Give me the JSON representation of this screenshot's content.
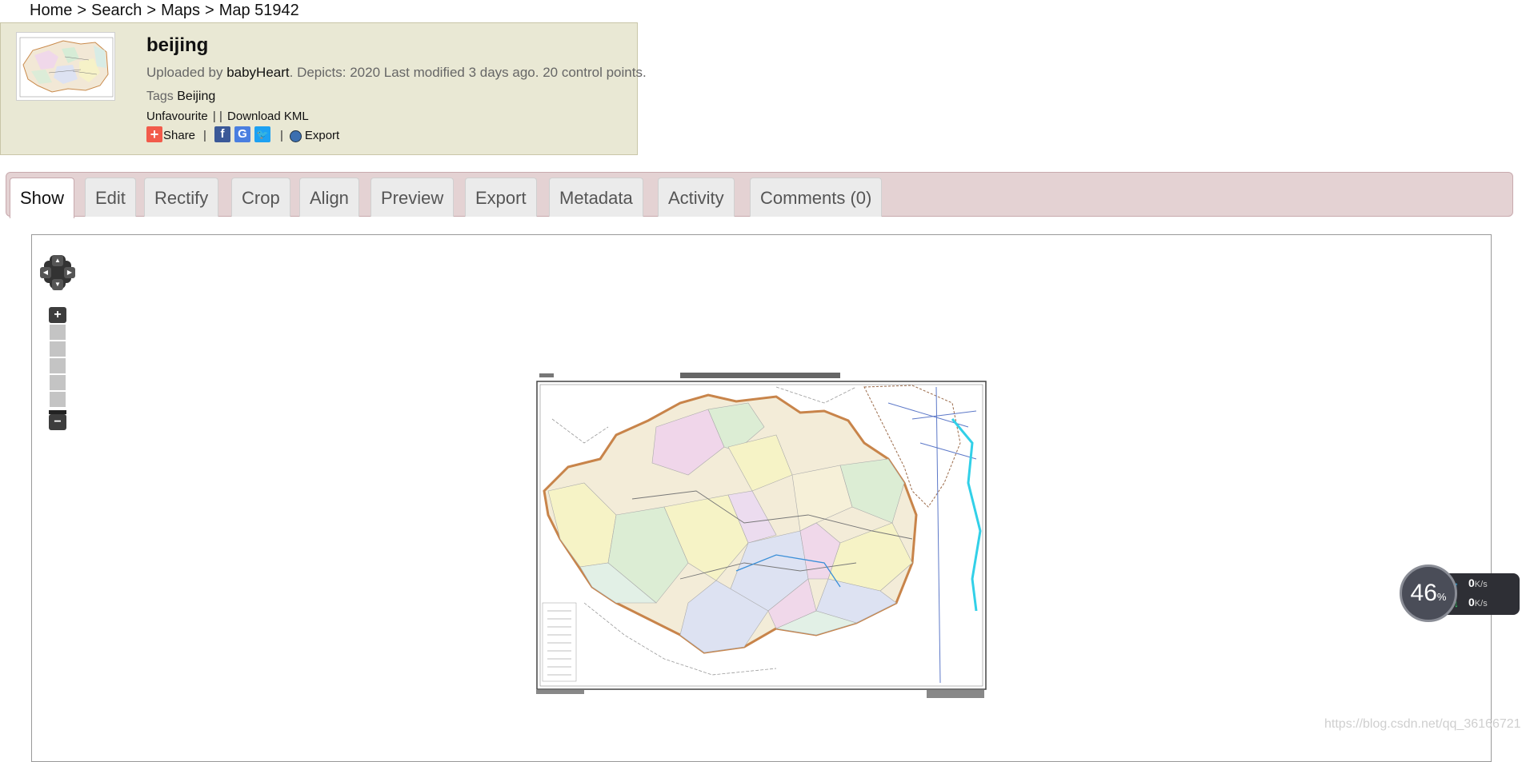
{
  "breadcrumb": {
    "home": "Home",
    "search": "Search",
    "maps": "Maps",
    "current": "Map 51942",
    "separator": ">"
  },
  "map": {
    "title": "beijing",
    "uploaded_prefix": "Uploaded by ",
    "uploader": "babyHeart",
    "details": ". Depicts: 2020 Last modified 3 days ago. 20 control points.",
    "tags_label": "Tags ",
    "tag": "Beijing",
    "unfavourite": "Unfavourite",
    "link_sep": "| |",
    "download_kml": "Download KML",
    "share": "Share",
    "export": "Export"
  },
  "tabs": [
    "Show",
    "Edit",
    "Rectify",
    "Crop",
    "Align",
    "Preview",
    "Export",
    "Metadata",
    "Activity",
    "Comments (0)"
  ],
  "active_tab": "Show",
  "zoom": {
    "in_label": "+",
    "out_label": "−",
    "levels": 5
  },
  "widget": {
    "percent": "46",
    "percent_unit": "%",
    "up_rate": "0",
    "down_rate": "0",
    "rate_unit": "K/s"
  },
  "watermark": "https://blog.csdn.net/qq_36166721",
  "colors": {
    "infobox_bg": "#e9e8d4",
    "tabs_bg": "#e4d2d3",
    "share_red": "#f25b4b",
    "facebook": "#3b5998",
    "google": "#4a7fe0",
    "twitter": "#1da1f2"
  },
  "icons": {
    "share": "plus-square-icon",
    "facebook": "facebook-icon",
    "google": "google-icon",
    "twitter": "twitter-icon",
    "export": "globe-icon"
  }
}
